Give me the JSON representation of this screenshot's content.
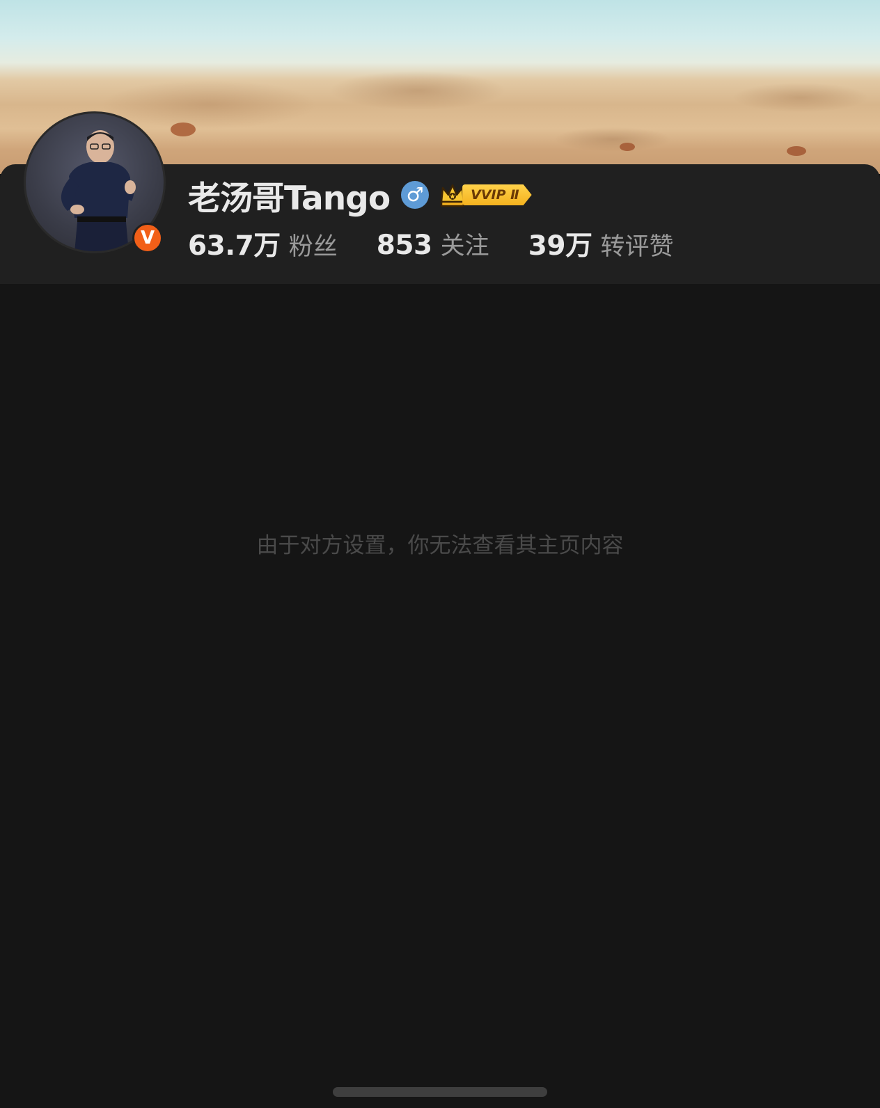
{
  "profile": {
    "username": "老汤哥Tango",
    "verified_badge": "V",
    "gender_symbol": "♂",
    "vip_label": "VVIP Ⅱ",
    "vip_crown_symbol": "♛"
  },
  "stats": {
    "fans": {
      "value": "63.7万",
      "label": "粉丝"
    },
    "following": {
      "value": "853",
      "label": "关注"
    },
    "interactions": {
      "value": "39万",
      "label": "转评赞"
    }
  },
  "message": "由于对方设置，你无法查看其主页内容",
  "icons": {
    "gender": "male-gender-icon",
    "verified": "verified-v-icon",
    "vip": "vvip-crown-icon"
  },
  "colors": {
    "background": "#151515",
    "card": "#202020",
    "verified_badge": "#f25f18",
    "gender_icon": "#5e9bd6",
    "vip_gold": "#f4b21f"
  }
}
